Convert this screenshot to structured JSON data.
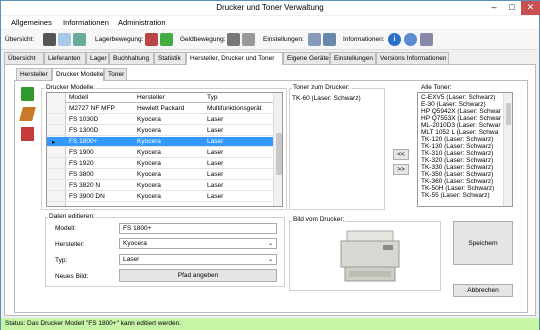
{
  "window": {
    "title": "Drucker und Toner Verwaltung"
  },
  "menu": [
    "Allgemeines",
    "Informationen",
    "Administration"
  ],
  "toolbar": {
    "uebersicht": "Übersicht:",
    "lagerbewegung": "Lagerbewegung:",
    "geldbewegung": "Geldbewegung:",
    "einstellungen": "Einstellungen:",
    "informationen": "Informationen:"
  },
  "main_tabs": [
    "Übersicht",
    "Lieferanten",
    "Lager",
    "Buchhaltung",
    "Statistik",
    "Hersteller, Drucker und Toner",
    "Eigene Geräte",
    "Einstellungen",
    "Versions Informationen"
  ],
  "sub_tabs": [
    "Hersteller",
    "Drucker Modelle",
    "Toner"
  ],
  "models": {
    "label": "Drucker Modelle:",
    "columns": [
      "Modell",
      "Hersteller",
      "Typ"
    ],
    "rows": [
      [
        "M2727 NF MFP",
        "Hewlett Packard",
        "Multifunktionsgerät"
      ],
      [
        "FS 1030D",
        "Kyocera",
        "Laser"
      ],
      [
        "FS 1300D",
        "Kyocera",
        "Laser"
      ],
      [
        "FS 1800+",
        "Kyocera",
        "Laser"
      ],
      [
        "FS 1900",
        "Kyocera",
        "Laser"
      ],
      [
        "FS 1920",
        "Kyocera",
        "Laser"
      ],
      [
        "FS 3800",
        "Kyocera",
        "Laser"
      ],
      [
        "FS 3820 N",
        "Kyocera",
        "Laser"
      ],
      [
        "FS 3900 DN",
        "Kyocera",
        "Laser"
      ]
    ]
  },
  "toner_for_printer": {
    "label": "Toner zum Drucker:",
    "items": [
      "TK-60 (Laser: Schwarz)"
    ]
  },
  "all_toner": {
    "label": "Alle Toner:",
    "items": [
      "C-EXV5 (Laser: Schwarz)",
      "E-30 (Laser: Schwarz)",
      "HP Q5942X (Laser: Schwar",
      "HP Q7553X (Laser: Schwar",
      "ML-2010D3 (Laser: Schwar",
      "MLT 1052 L (Laser: Schwa",
      "TK-120 (Laser: Schwarz)",
      "TK-130 (Laser: Schwarz)",
      "TK-310 (Laser: Schwarz)",
      "TK-320 (Laser: Schwarz)",
      "TK-330 (Laser: Schwarz)",
      "TK-350 (Laser: Schwarz)",
      "TK-360 (Laser: Schwarz)",
      "TK-50H (Laser: Schwarz)",
      "TK-55 (Laser: Schwarz)"
    ]
  },
  "buttons": {
    "left": "<<",
    "right": ">>",
    "save": "Speichern",
    "cancel": "Abbrechen",
    "choose_path": "Pfad angeben"
  },
  "edit": {
    "label": "Daten editieren:",
    "modell_label": "Modell:",
    "modell_value": "FS 1800+",
    "hersteller_label": "Hersteller:",
    "hersteller_value": "Kyocera",
    "typ_label": "Typ:",
    "typ_value": "Laser",
    "bild_label": "Neues Bild:"
  },
  "image_box": {
    "label": "Bild vom Drucker:"
  },
  "status": "Status: Das Drucker Modell \"FS 1800+\" kann editiert werden."
}
